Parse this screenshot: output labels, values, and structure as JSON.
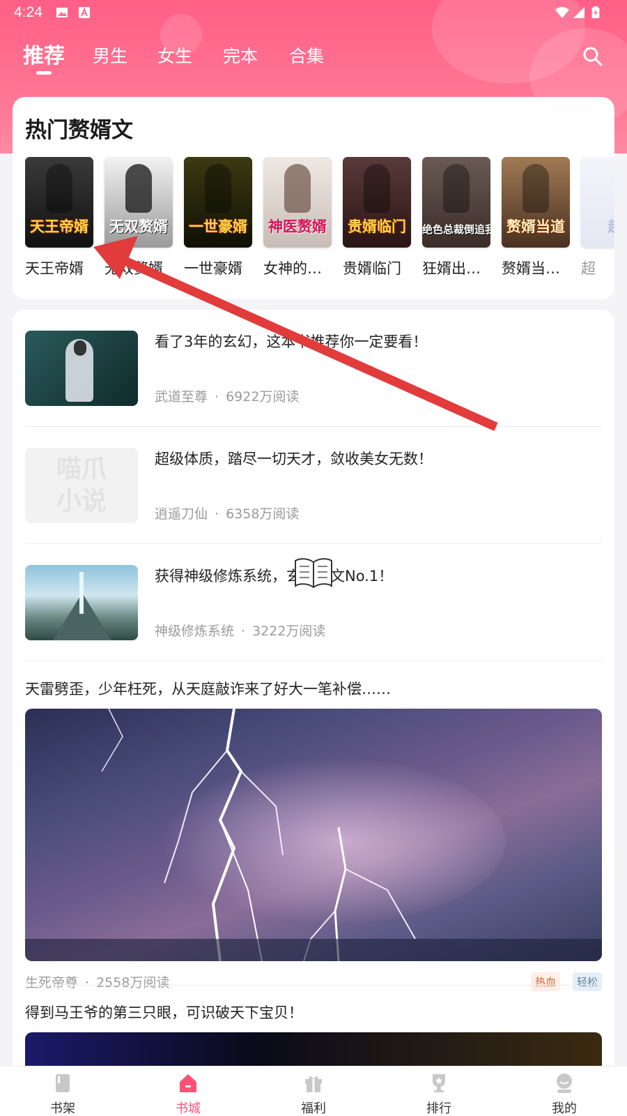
{
  "status_bar": {
    "time": "4:24"
  },
  "nav": {
    "tabs": [
      {
        "label": "推荐",
        "active": true
      },
      {
        "label": "男生"
      },
      {
        "label": "女生"
      },
      {
        "label": "完本"
      },
      {
        "label": "合集"
      }
    ],
    "search_icon": "search-icon"
  },
  "hot_section": {
    "title": "热门赘婿文",
    "books": [
      {
        "name": "天王帝婿",
        "cover_text": "天王帝婿",
        "cover_color": "#2a2a2a"
      },
      {
        "name": "无双赘婿",
        "cover_text": "无双赘婿",
        "cover_color": "#d8d8d8"
      },
      {
        "name": "一世豪婿",
        "cover_text": "一世豪婿",
        "cover_color": "#2b2a10"
      },
      {
        "name": "女神的…",
        "cover_text": "神医赘婿",
        "cover_color": "#d9d3cf"
      },
      {
        "name": "贵婿临门",
        "cover_text": "贵婿临门",
        "cover_color": "#4a2a2a"
      },
      {
        "name": "狂婿出…",
        "cover_text": "绝色总裁倒追我",
        "cover_color": "#5a4a44"
      },
      {
        "name": "赘婿当…",
        "cover_text": "赘婿当道",
        "cover_color": "#7a5a44"
      },
      {
        "name": "超",
        "cover_text": "超",
        "cover_color": "#eef0f8"
      }
    ]
  },
  "feed": {
    "items": [
      {
        "desc": "看了3年的玄幻，这本书推荐你一定要看！",
        "book": "武道至尊",
        "reads": "6922万阅读",
        "thumb_color": "#1f4a4a"
      },
      {
        "desc": "超级体质，踏尽一切天才，敛收美女无数！",
        "book": "逍遥刀仙",
        "reads": "6358万阅读",
        "thumb_color": "#f0f0f0",
        "placeholder": "喵爪小说"
      },
      {
        "desc": "获得神级修炼系统，玄幻爽文No.1！",
        "book": "神级修炼系统",
        "reads": "3222万阅读",
        "thumb_color": "#5c8fa8"
      }
    ],
    "big_items": [
      {
        "title": "天雷劈歪，少年枉死，从天庭敲诈来了好大一笔补偿……",
        "book": "生死帝尊",
        "reads": "2558万阅读",
        "tags": [
          "热血",
          "轻松"
        ]
      },
      {
        "title": "得到马王爷的第三只眼，可识破天下宝贝！"
      }
    ],
    "separator": "·"
  },
  "tabbar": {
    "items": [
      {
        "label": "书架",
        "icon": "bookshelf-icon"
      },
      {
        "label": "书城",
        "icon": "home-icon",
        "active": true
      },
      {
        "label": "福利",
        "icon": "gift-icon"
      },
      {
        "label": "排行",
        "icon": "trophy-icon"
      },
      {
        "label": "我的",
        "icon": "profile-icon"
      }
    ]
  },
  "colors": {
    "brand": "#ff5f86",
    "active_tab": "#ff5078"
  }
}
